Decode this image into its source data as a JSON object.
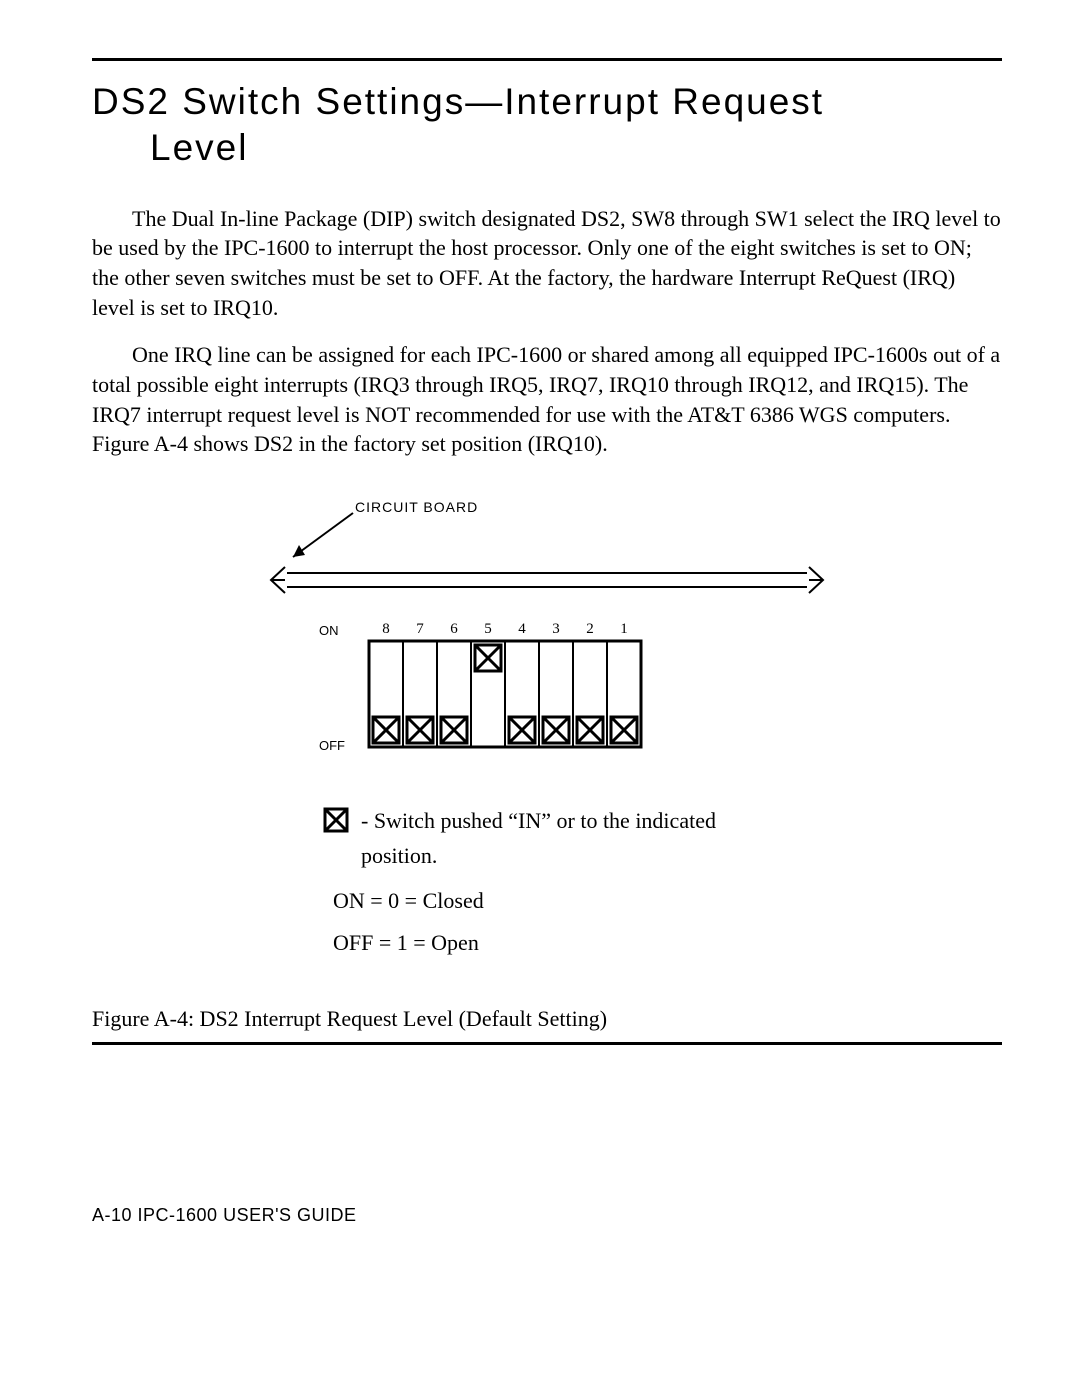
{
  "title": {
    "line1": "DS2 Switch Settings—Interrupt Request",
    "line2": "Level"
  },
  "para1": "The Dual In-line Package (DIP) switch designated DS2, SW8 through SW1 select the IRQ level to be used by the IPC-1600 to interrupt the host processor. Only one of the eight switches is set to ON; the other seven switches must be set to OFF. At the factory, the hardware Interrupt ReQuest (IRQ) level is set to IRQ10.",
  "para2": "One IRQ line can be assigned for each IPC-1600 or shared among all equipped IPC-1600s out of a total possible eight interrupts (IRQ3 through IRQ5, IRQ7, IRQ10 through IRQ12, and IRQ15). The IRQ7 interrupt request level is NOT recommended for use with the AT&T 6386 WGS computers. Figure A-4 shows DS2 in the factory set position (IRQ10).",
  "diagram": {
    "circuit_board_label": "CIRCUIT BOARD",
    "on_label": "ON",
    "off_label": "OFF",
    "switch_numbers": [
      "8",
      "7",
      "6",
      "5",
      "4",
      "3",
      "2",
      "1"
    ]
  },
  "legend": {
    "pushed_text": "- Switch pushed “IN” or to the indicated position.",
    "on_eq": "ON = 0 = Closed",
    "off_eq": "OFF = 1 = Open"
  },
  "figure_caption": "Figure A-4:  DS2 Interrupt Request Level (Default Setting)",
  "footer": "A-10  IPC-1600 USER'S GUIDE"
}
